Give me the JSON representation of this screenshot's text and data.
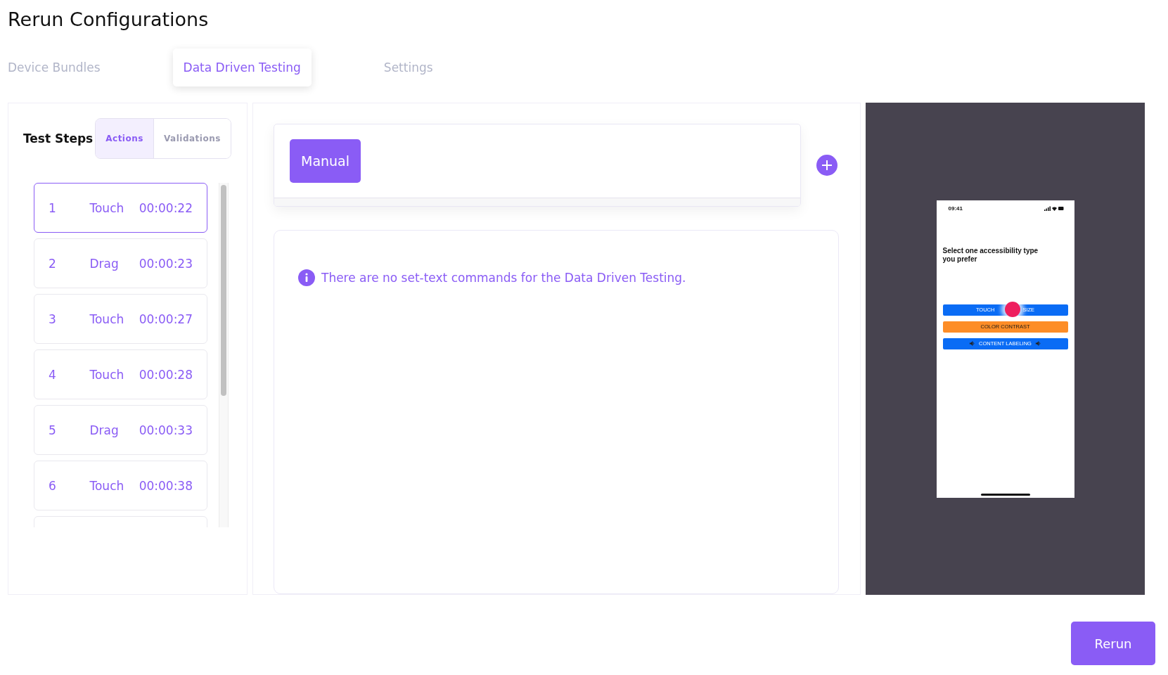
{
  "title": "Rerun Configurations",
  "tabs": [
    {
      "label": "Device Bundles",
      "selected": false
    },
    {
      "label": "Data Driven Testing",
      "selected": true
    },
    {
      "label": "Settings",
      "selected": false
    }
  ],
  "test_steps": {
    "heading": "Test Steps",
    "segments": [
      {
        "label": "Actions",
        "selected": true
      },
      {
        "label": "Validations",
        "selected": false
      }
    ],
    "steps": [
      {
        "number": "1",
        "action": "Touch",
        "time": "00:00:22",
        "selected": true
      },
      {
        "number": "2",
        "action": "Drag",
        "time": "00:00:23",
        "selected": false
      },
      {
        "number": "3",
        "action": "Touch",
        "time": "00:00:27",
        "selected": false
      },
      {
        "number": "4",
        "action": "Touch",
        "time": "00:00:28",
        "selected": false
      },
      {
        "number": "5",
        "action": "Drag",
        "time": "00:00:33",
        "selected": false
      },
      {
        "number": "6",
        "action": "Touch",
        "time": "00:00:38",
        "selected": false
      }
    ]
  },
  "data_sets": {
    "chips": [
      {
        "label": "Manual",
        "selected": true
      }
    ]
  },
  "info_message": "There are no set-text commands for the Data Driven Testing.",
  "device_screen": {
    "time": "09:41",
    "heading": "Select one accessibility type you prefer",
    "options": [
      {
        "kind": "split",
        "parts": [
          "TOUCH",
          "SIZE"
        ],
        "color": "#0a6cf5",
        "touched": true
      },
      {
        "kind": "plain",
        "label": "COLOR CONTRAST",
        "color": "#fd8d27",
        "touched": false
      },
      {
        "kind": "icons",
        "label": "CONTENT LABELING",
        "color": "#0a6cf5",
        "touched": false
      }
    ]
  },
  "rerun_button": "Rerun"
}
